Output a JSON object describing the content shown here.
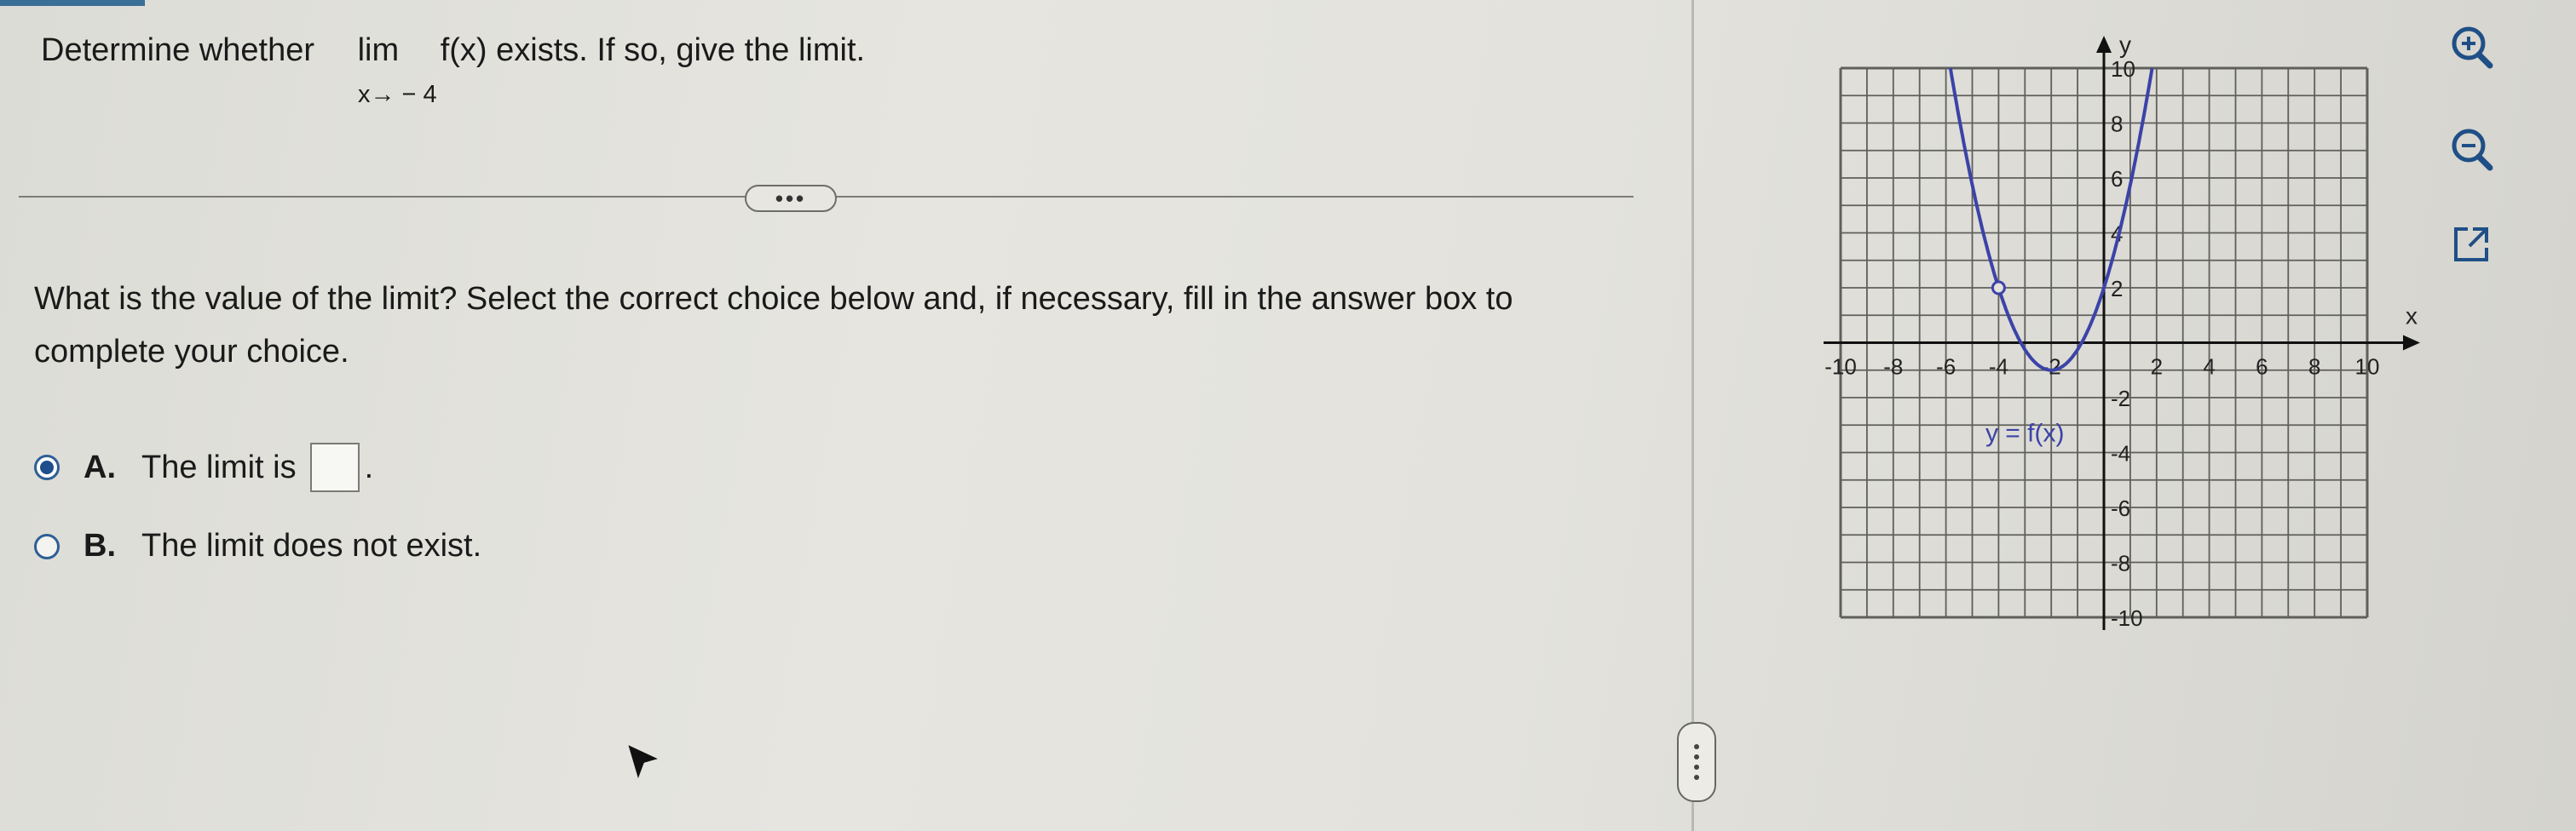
{
  "question": {
    "prefix": "Determine whether",
    "lim_word": "lim",
    "lim_sub": "x→ − 4",
    "suffix": "f(x) exists. If so, give the limit."
  },
  "more_button_label": "•••",
  "prompt": "What is the value of the limit? Select the correct choice below and, if necessary, fill in the answer box to complete your choice.",
  "choices": [
    {
      "letter": "A.",
      "text": "The limit is",
      "after": ".",
      "selected": true
    },
    {
      "letter": "B.",
      "text": "The limit does not exist.",
      "selected": false
    }
  ],
  "graph": {
    "x_axis_label": "x",
    "y_axis_label": "y",
    "x_tick_labels": [
      "-10",
      "-8",
      "-6",
      "-4",
      "-2",
      "2",
      "4",
      "6",
      "8",
      "10"
    ],
    "y_tick_labels": [
      "10",
      "8",
      "6",
      "4",
      "2",
      "-2",
      "-4",
      "-6",
      "-8",
      "-10"
    ],
    "x_ticks": [
      -10,
      -8,
      -6,
      -4,
      -2,
      2,
      4,
      6,
      8,
      10
    ],
    "y_ticks": [
      10,
      8,
      6,
      4,
      2,
      -2,
      -4,
      -6,
      -8,
      -10
    ],
    "curve_label": "y = f(x)",
    "range": [
      -10,
      10
    ],
    "grid_step": 1,
    "curve": {
      "type": "parabola",
      "vertex": [
        -2,
        -1
      ],
      "a": 0.75
    },
    "open_point": [
      -4,
      2
    ],
    "colors": {
      "curve": "#3b43a8",
      "grid": "#5f5f5c",
      "axis": "#111111"
    }
  },
  "tools": [
    "zoom-in-icon",
    "zoom-out-icon",
    "external-link-icon"
  ]
}
